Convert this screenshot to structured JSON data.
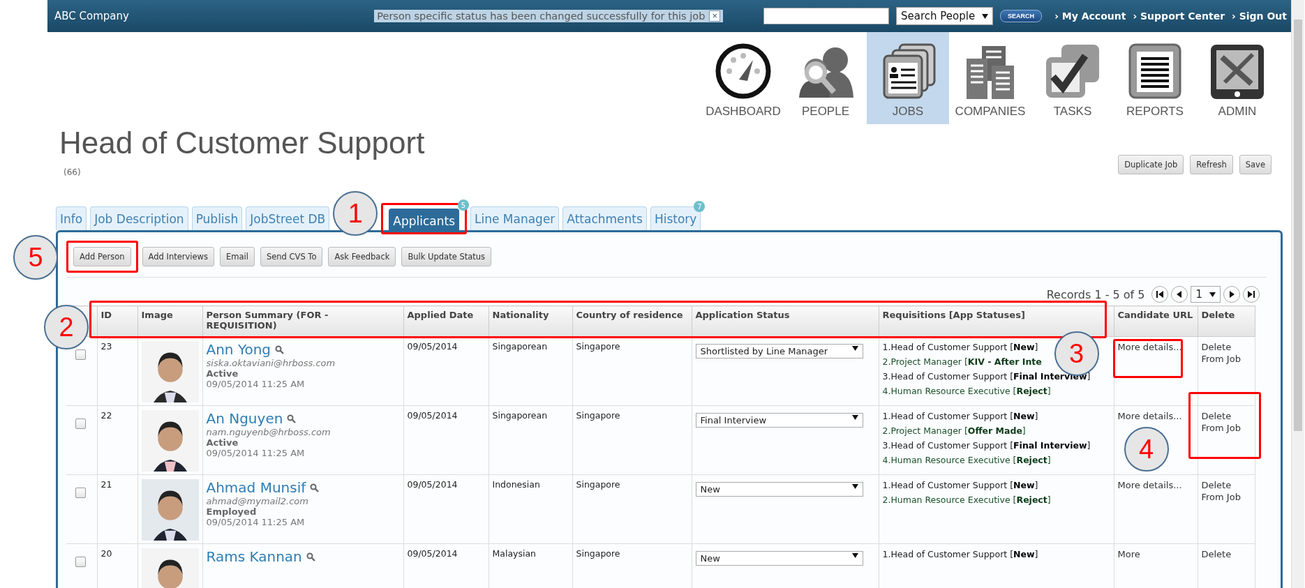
{
  "top_bar": {
    "company": "ABC Company",
    "notice": "Person specific status has been changed successfully for this job",
    "notice_close": "×",
    "search_select": "Search People",
    "search_button": "SEARCH",
    "links": [
      "› My Account",
      "› Support Center",
      "› Sign Out"
    ]
  },
  "nav": [
    {
      "label": "DASHBOARD",
      "selected": false
    },
    {
      "label": "PEOPLE",
      "selected": false
    },
    {
      "label": "JOBS",
      "selected": true
    },
    {
      "label": "COMPANIES",
      "selected": false
    },
    {
      "label": "TASKS",
      "selected": false
    },
    {
      "label": "REPORTS",
      "selected": false
    },
    {
      "label": "ADMIN",
      "selected": false
    }
  ],
  "job": {
    "title": "Head of Customer Support",
    "count": "(66)"
  },
  "actions": [
    "Duplicate Job",
    "Refresh",
    "Save"
  ],
  "tabs": [
    {
      "label": "Info",
      "selected": false
    },
    {
      "label": "Job Description",
      "selected": false
    },
    {
      "label": "Publish",
      "selected": false
    },
    {
      "label": "JobStreet DB",
      "selected": false
    },
    {
      "label": "Applicants",
      "selected": true,
      "badge": "5"
    },
    {
      "label": "Line Manager",
      "selected": false
    },
    {
      "label": "Attachments",
      "selected": false
    },
    {
      "label": "History",
      "selected": false,
      "badge": "7"
    }
  ],
  "toolbar": [
    "Add Person",
    "Add Interviews",
    "Email",
    "Send CVS To",
    "Ask Feedback",
    "Bulk Update Status"
  ],
  "paging": {
    "records": "Records 1 - 5 of 5",
    "page": "1"
  },
  "table": {
    "columns": [
      "ID",
      "Image",
      "Person Summary (FOR - REQUISITION)",
      "Applied Date",
      "Nationality",
      "Country of residence",
      "Application Status",
      "Requisitions [App Statuses]",
      "Candidate URL",
      "Delete"
    ],
    "rows": [
      {
        "checked": false,
        "id": "23",
        "name": "Ann Yong",
        "email": "siska.oktaviani@hrboss.com",
        "status": "Active",
        "updated": "09/05/2014 11:25 AM",
        "applied": "09/05/2014",
        "nationality": "Singaporean",
        "country": "Singapore",
        "app_status": "Shortlisted by Line Manager",
        "requisitions": [
          "1.Head of Customer Support [**New**]",
          "2.Project Manager [**KIV - After Inte**",
          "3.Head of Customer Support [**Final Interview**]",
          "4.Human Resource Executive [**Reject**]"
        ],
        "candidate_url": "More details...",
        "delete": "Delete From Job"
      },
      {
        "checked": false,
        "id": "22",
        "name": "An Nguyen",
        "email": "nam.nguyenb@hrboss.com",
        "status": "Active",
        "updated": "09/05/2014 11:25 AM",
        "applied": "09/05/2014",
        "nationality": "Singaporean",
        "country": "Singapore",
        "app_status": "Final Interview",
        "requisitions": [
          "1.Head of Customer Support [**New**]",
          "2.Project Manager [**Offer Made**]",
          "3.Head of Customer Support [**Final Interview**]",
          "4.Human Resource Executive [**Reject**]"
        ],
        "candidate_url": "More details...",
        "delete": "Delete From Job"
      },
      {
        "checked": false,
        "id": "21",
        "name": "Ahmad Munsif",
        "email": "ahmad@mymail2.com",
        "status": "Employed",
        "updated": "09/05/2014 11:25 AM",
        "applied": "09/05/2014",
        "nationality": "Indonesian",
        "country": "Singapore",
        "app_status": "New",
        "requisitions": [
          "1.Head of Customer Support [**New**]",
          "2.Human Resource Executive [**Reject**]"
        ],
        "candidate_url": "More details...",
        "delete": "Delete From Job"
      },
      {
        "checked": false,
        "id": "20",
        "name": "Rams Kannan",
        "applied": "09/05/2014",
        "nationality": "Malaysian",
        "country": "Singapore",
        "app_status": "New",
        "requisitions": [
          "1.Head of Customer Support [**New**]"
        ],
        "candidate_url": "More",
        "delete": "Delete"
      }
    ]
  },
  "callouts": [
    "1",
    "2",
    "3",
    "4",
    "5"
  ]
}
